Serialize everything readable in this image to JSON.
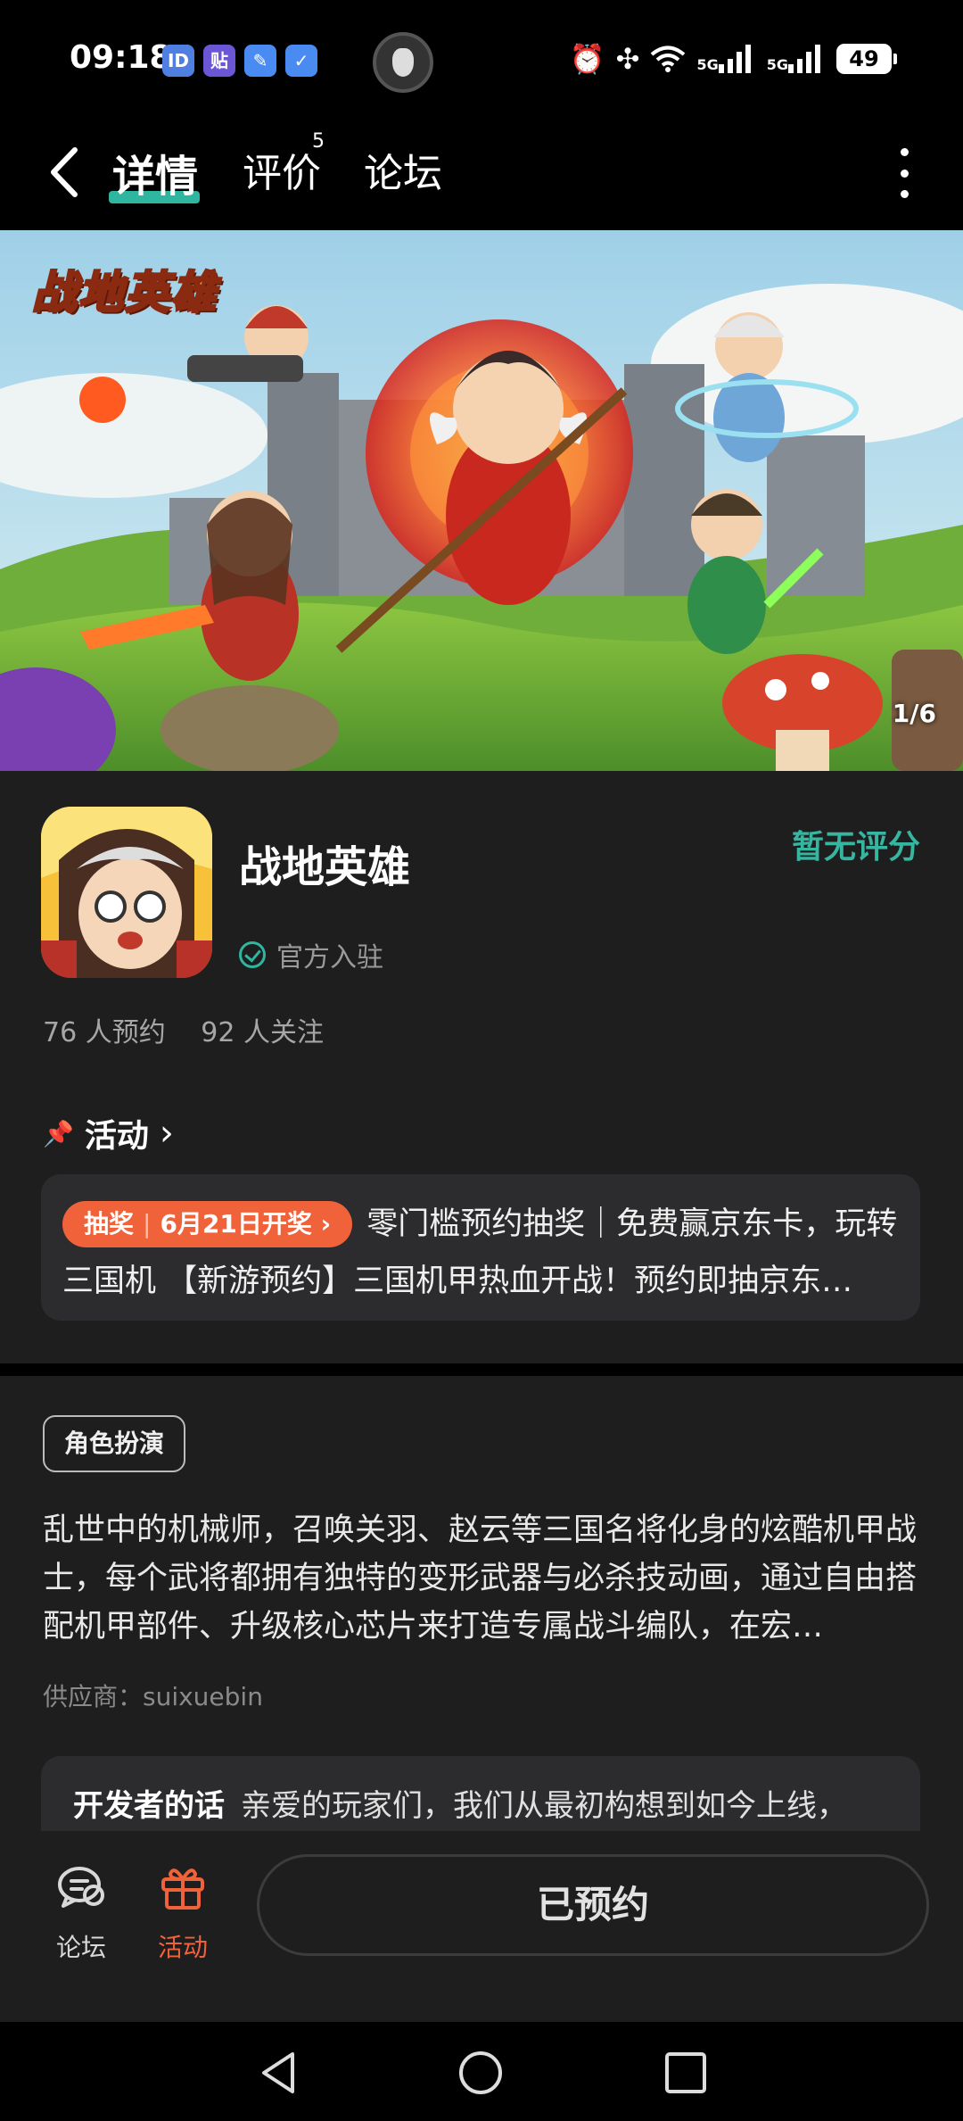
{
  "status_bar": {
    "time": "09:18",
    "app_icons": [
      "ID",
      "贴",
      "✎",
      "✓"
    ],
    "network_1": "5G",
    "network_2": "5G",
    "battery": "49"
  },
  "nav": {
    "tabs": [
      {
        "label": "详情",
        "active": true
      },
      {
        "label": "评价",
        "badge": "5"
      },
      {
        "label": "论坛"
      }
    ]
  },
  "banner": {
    "logo_text": "战地英雄",
    "counter": "1/6"
  },
  "game": {
    "name": "战地英雄",
    "verified_label": "官方入驻",
    "rating": "暂无评分",
    "reservations": "76 人预约",
    "followers": "92 人关注"
  },
  "activity": {
    "section_title": "活动",
    "tag_type": "抽奖",
    "tag_date": "6月21日开奖",
    "text": "零门槛预约抽奖｜免费赢京东卡，玩转三国机 【新游预约】三国机甲热血开战！预约即抽京东…"
  },
  "description": {
    "genre": "角色扮演",
    "text": "乱世中的机械师，召唤关羽、赵云等三国名将化身的炫酷机甲战士，每个武将都拥有独特的变形武器与必杀技动画，通过自由搭配机甲部件、升级核心芯片来打造专属战斗编队，在宏…",
    "supplier": "供应商：suixuebin"
  },
  "developer_note": {
    "title": "开发者的话",
    "text": "亲爱的玩家们，我们从最初构想到如今上线，"
  },
  "bottom_bar": {
    "forum_label": "论坛",
    "activity_label": "活动",
    "reserve_button": "已预约"
  },
  "colors": {
    "accent": "#2eb6a0",
    "activity_orange": "#f0623a",
    "background": "#1e1e1f"
  }
}
